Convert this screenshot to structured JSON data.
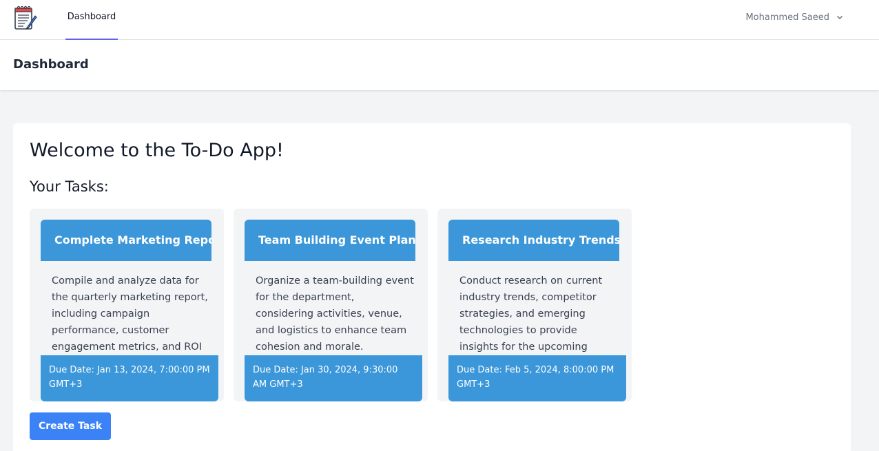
{
  "nav": {
    "logo_icon": "notepad-pencil-icon",
    "dashboard_link": "Dashboard",
    "user_name": "Mohammed Saeed",
    "user_menu_icon": "chevron-down-icon"
  },
  "header": {
    "title": "Dashboard"
  },
  "main": {
    "welcome": "Welcome to the To-Do App!",
    "tasks_heading": "Your Tasks:",
    "tasks": [
      {
        "title": "Complete Marketing Report",
        "description": "Compile and analyze data for the quarterly marketing report, including campaign performance, customer engagement metrics, and ROI",
        "due": "Due Date: Jan 13, 2024, 7:00:00 PM GMT+3"
      },
      {
        "title": "Team Building Event Planning",
        "description": "Organize a team-building event for the department, considering activities, venue, and logistics to enhance team cohesion and morale.",
        "due": "Due Date: Jan 30, 2024, 9:30:00 AM GMT+3"
      },
      {
        "title": "Research Industry Trends",
        "description": "Conduct research on current industry trends, competitor strategies, and emerging technologies to provide insights for the upcoming",
        "due": "Due Date: Feb 5, 2024, 8:00:00 PM GMT+3"
      }
    ],
    "create_button": "Create Task"
  },
  "colors": {
    "card_accent": "#3b97d9",
    "button": "#3b82f6",
    "nav_active": "#6366f1"
  }
}
